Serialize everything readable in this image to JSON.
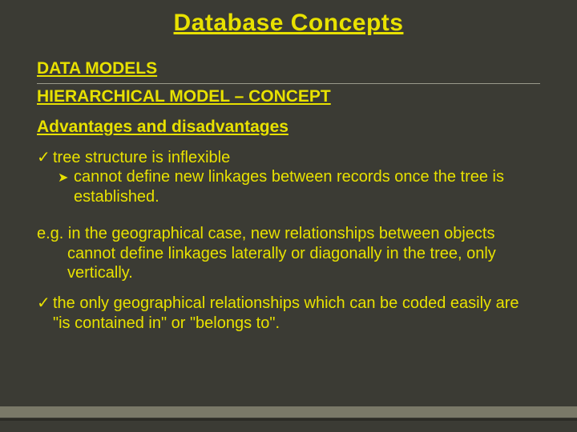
{
  "title": "Database Concepts",
  "section": "DATA MODELS",
  "subsection": "HIERARCHICAL MODEL – CONCEPT",
  "subheading": "Advantages and disadvantages",
  "bullets": {
    "b1": "tree structure is inflexible",
    "b1a": "cannot define new linkages between records once the tree is established.",
    "para": "e.g. in the geographical case, new relationships between objects cannot define linkages laterally or diagonally in the tree, only vertically.",
    "b2": "the only geographical relationships which can be coded easily are \"is contained in\" or \"belongs to\"."
  }
}
